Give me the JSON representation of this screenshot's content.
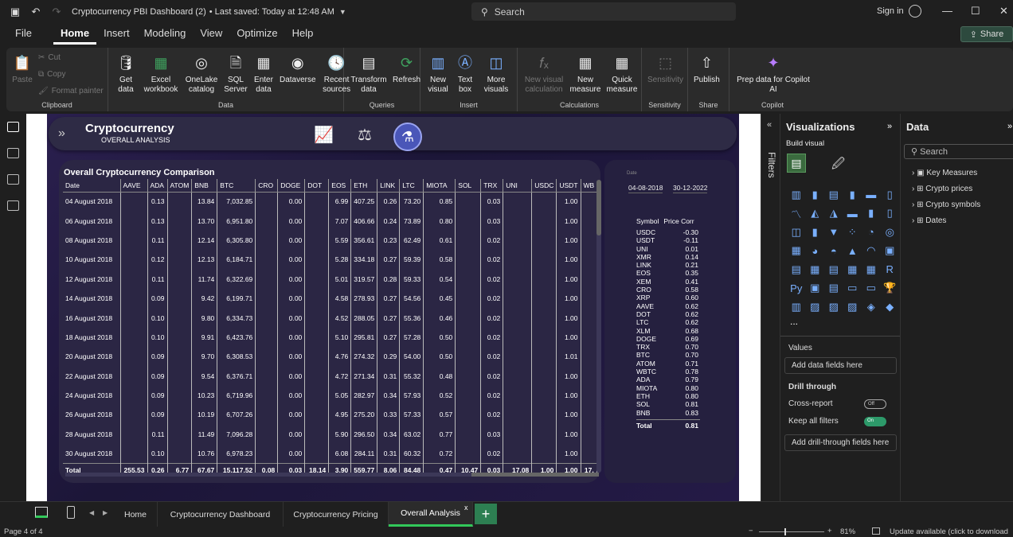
{
  "titlebar": {
    "title": "Cryptocurrency PBI Dashboard (2)",
    "saved": "• Last saved: Today at 12:48 AM",
    "search_placeholder": "Search",
    "signin": "Sign in"
  },
  "menu": [
    "File",
    "Home",
    "Insert",
    "Modeling",
    "View",
    "Optimize",
    "Help"
  ],
  "share_label": "Share",
  "ribbon": {
    "clipboard": {
      "label": "Clipboard",
      "paste": "Paste",
      "cut": "Cut",
      "copy": "Copy",
      "format_painter": "Format painter"
    },
    "data": {
      "label": "Data",
      "get_data": "Get data",
      "excel": "Excel workbook",
      "onelake": "OneLake catalog",
      "sql": "SQL Server",
      "enter": "Enter data",
      "dataverse": "Dataverse",
      "recent": "Recent sources"
    },
    "queries": {
      "label": "Queries",
      "transform": "Transform data",
      "refresh": "Refresh"
    },
    "insert": {
      "label": "Insert",
      "new_visual": "New visual",
      "text_box": "Text box",
      "more_visuals": "More visuals"
    },
    "calculations": {
      "label": "Calculations",
      "new_visual_calc": "New visual calculation",
      "new_measure": "New measure",
      "quick_measure": "Quick measure"
    },
    "sensitivity": {
      "label": "Sensitivity",
      "btn": "Sensitivity"
    },
    "share": {
      "label": "Share",
      "publish": "Publish"
    },
    "copilot": {
      "label": "Copilot",
      "prep": "Prep data for Copilot AI"
    }
  },
  "report": {
    "title": "Cryptocurrency",
    "subtitle": "OVERALL ANALYSIS",
    "table_title": "Overall Cryptocurrency Comparison",
    "columns": [
      "Date",
      "AAVE",
      "ADA",
      "ATOM",
      "BNB",
      "BTC",
      "CRO",
      "DOGE",
      "DOT",
      "EOS",
      "ETH",
      "LINK",
      "LTC",
      "MIOTA",
      "SOL",
      "TRX",
      "UNI",
      "USDC",
      "USDT",
      "WB"
    ],
    "rows": [
      [
        "04 August 2018",
        "",
        "0.13",
        "",
        "13.84",
        "7,032.85",
        "",
        "0.00",
        "",
        "6.99",
        "407.25",
        "0.26",
        "73.20",
        "0.85",
        "",
        "0.03",
        "",
        "",
        "1.00",
        ""
      ],
      [
        "06 August 2018",
        "",
        "0.13",
        "",
        "13.70",
        "6,951.80",
        "",
        "0.00",
        "",
        "7.07",
        "406.66",
        "0.24",
        "73.89",
        "0.80",
        "",
        "0.03",
        "",
        "",
        "1.00",
        ""
      ],
      [
        "08 August 2018",
        "",
        "0.11",
        "",
        "12.14",
        "6,305.80",
        "",
        "0.00",
        "",
        "5.59",
        "356.61",
        "0.23",
        "62.49",
        "0.61",
        "",
        "0.02",
        "",
        "",
        "1.00",
        ""
      ],
      [
        "10 August 2018",
        "",
        "0.12",
        "",
        "12.13",
        "6,184.71",
        "",
        "0.00",
        "",
        "5.28",
        "334.18",
        "0.27",
        "59.39",
        "0.58",
        "",
        "0.02",
        "",
        "",
        "1.00",
        ""
      ],
      [
        "12 August 2018",
        "",
        "0.11",
        "",
        "11.74",
        "6,322.69",
        "",
        "0.00",
        "",
        "5.01",
        "319.57",
        "0.28",
        "59.33",
        "0.54",
        "",
        "0.02",
        "",
        "",
        "1.00",
        ""
      ],
      [
        "14 August 2018",
        "",
        "0.09",
        "",
        "9.42",
        "6,199.71",
        "",
        "0.00",
        "",
        "4.58",
        "278.93",
        "0.27",
        "54.56",
        "0.45",
        "",
        "0.02",
        "",
        "",
        "1.00",
        ""
      ],
      [
        "16 August 2018",
        "",
        "0.10",
        "",
        "9.80",
        "6,334.73",
        "",
        "0.00",
        "",
        "4.52",
        "288.05",
        "0.27",
        "55.36",
        "0.46",
        "",
        "0.02",
        "",
        "",
        "1.00",
        ""
      ],
      [
        "18 August 2018",
        "",
        "0.10",
        "",
        "9.91",
        "6,423.76",
        "",
        "0.00",
        "",
        "5.10",
        "295.81",
        "0.27",
        "57.28",
        "0.50",
        "",
        "0.02",
        "",
        "",
        "1.00",
        ""
      ],
      [
        "20 August 2018",
        "",
        "0.09",
        "",
        "9.70",
        "6,308.53",
        "",
        "0.00",
        "",
        "4.76",
        "274.32",
        "0.29",
        "54.00",
        "0.50",
        "",
        "0.02",
        "",
        "",
        "1.01",
        ""
      ],
      [
        "22 August 2018",
        "",
        "0.09",
        "",
        "9.54",
        "6,376.71",
        "",
        "0.00",
        "",
        "4.72",
        "271.34",
        "0.31",
        "55.32",
        "0.48",
        "",
        "0.02",
        "",
        "",
        "1.00",
        ""
      ],
      [
        "24 August 2018",
        "",
        "0.09",
        "",
        "10.23",
        "6,719.96",
        "",
        "0.00",
        "",
        "5.05",
        "282.97",
        "0.34",
        "57.93",
        "0.52",
        "",
        "0.02",
        "",
        "",
        "1.00",
        ""
      ],
      [
        "26 August 2018",
        "",
        "0.09",
        "",
        "10.19",
        "6,707.26",
        "",
        "0.00",
        "",
        "4.95",
        "275.20",
        "0.33",
        "57.33",
        "0.57",
        "",
        "0.02",
        "",
        "",
        "1.00",
        ""
      ],
      [
        "28 August 2018",
        "",
        "0.11",
        "",
        "11.49",
        "7,096.28",
        "",
        "0.00",
        "",
        "5.90",
        "296.50",
        "0.34",
        "63.02",
        "0.77",
        "",
        "0.03",
        "",
        "",
        "1.00",
        ""
      ],
      [
        "30 August 2018",
        "",
        "0.10",
        "",
        "10.76",
        "6,978.23",
        "",
        "0.00",
        "",
        "6.08",
        "284.11",
        "0.31",
        "60.32",
        "0.72",
        "",
        "0.02",
        "",
        "",
        "1.00",
        ""
      ]
    ],
    "total": [
      "Total",
      "255.53",
      "0.26",
      "6.77",
      "67.67",
      "15,117.52",
      "0.08",
      "0.03",
      "18.14",
      "3.90",
      "559.77",
      "8.06",
      "84.48",
      "0.47",
      "10.47",
      "0.03",
      "17.08",
      "1.00",
      "1.00",
      "17."
    ],
    "slicer_label": "Date",
    "date_from": "04-08-2018",
    "date_to": "30-12-2022",
    "corr_head_symbol": "Symbol",
    "corr_head_price": "Price Corr",
    "corr": [
      [
        "USDC",
        "-0.30"
      ],
      [
        "USDT",
        "-0.11"
      ],
      [
        "UNI",
        "0.01"
      ],
      [
        "XMR",
        "0.14"
      ],
      [
        "LINK",
        "0.21"
      ],
      [
        "EOS",
        "0.35"
      ],
      [
        "XEM",
        "0.41"
      ],
      [
        "CRO",
        "0.58"
      ],
      [
        "XRP",
        "0.60"
      ],
      [
        "AAVE",
        "0.62"
      ],
      [
        "DOT",
        "0.62"
      ],
      [
        "LTC",
        "0.62"
      ],
      [
        "XLM",
        "0.68"
      ],
      [
        "DOGE",
        "0.69"
      ],
      [
        "TRX",
        "0.70"
      ],
      [
        "BTC",
        "0.70"
      ],
      [
        "ATOM",
        "0.71"
      ],
      [
        "WBTC",
        "0.78"
      ],
      [
        "ADA",
        "0.79"
      ],
      [
        "MIOTA",
        "0.80"
      ],
      [
        "ETH",
        "0.80"
      ],
      [
        "SOL",
        "0.81"
      ],
      [
        "BNB",
        "0.83"
      ]
    ],
    "corr_total_label": "Total",
    "corr_total": "0.81"
  },
  "filters_label": "Filters",
  "viz": {
    "title": "Visualizations",
    "build": "Build visual",
    "values": "Values",
    "add_data": "Add data fields here",
    "drill": "Drill through",
    "cross": "Cross-report",
    "cross_state": "Off",
    "keep": "Keep all filters",
    "keep_state": "On",
    "add_drill": "Add drill-through fields here",
    "more": "..."
  },
  "data_pane": {
    "title": "Data",
    "search": "Search",
    "items": [
      "Key Measures",
      "Crypto prices",
      "Crypto symbols",
      "Dates"
    ]
  },
  "tabs": [
    "Home",
    "Cryptocurrency Dashboard",
    "Cryptocurrency Pricing",
    "Overall Analysis"
  ],
  "status": {
    "page": "Page 4 of 4",
    "zoom": "81%",
    "update": "Update available (click to download"
  }
}
